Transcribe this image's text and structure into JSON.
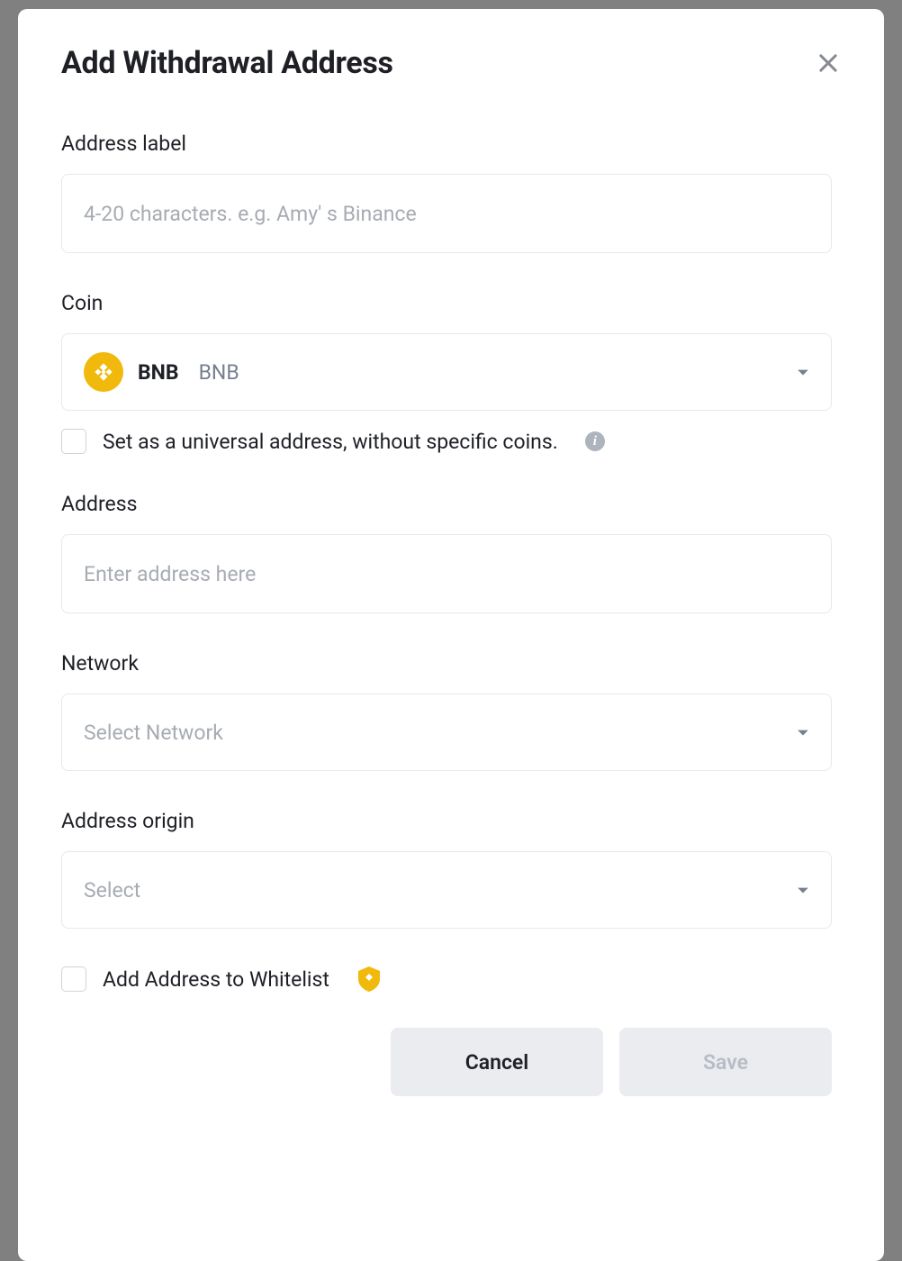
{
  "modal": {
    "title": "Add Withdrawal Address",
    "fields": {
      "address_label": {
        "label": "Address label",
        "placeholder": "4-20 characters. e.g. Amy' s Binance",
        "value": ""
      },
      "coin": {
        "label": "Coin",
        "selected_symbol": "BNB",
        "selected_name": "BNB",
        "universal_checkbox_label": "Set as a universal address, without specific coins.",
        "universal_checked": false
      },
      "address": {
        "label": "Address",
        "placeholder": "Enter address here",
        "value": ""
      },
      "network": {
        "label": "Network",
        "placeholder": "Select Network",
        "selected": ""
      },
      "address_origin": {
        "label": "Address origin",
        "placeholder": "Select",
        "selected": ""
      },
      "whitelist": {
        "label": "Add Address to Whitelist",
        "checked": false
      }
    },
    "buttons": {
      "cancel": "Cancel",
      "save": "Save"
    }
  }
}
